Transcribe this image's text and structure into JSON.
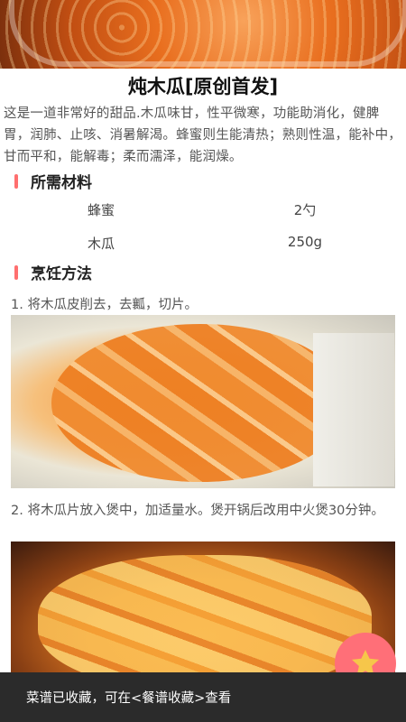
{
  "recipe": {
    "title": "炖木瓜[原创首发]",
    "intro": "这是一道非常好的甜品.木瓜味甘，性平微寒，功能助消化，健脾胃，润肺、止咳、消暑解渴。蜂蜜则生能清热；熟则性温，能补中，甘而平和，能解毒；柔而濡泽，能润燥。"
  },
  "ingredients": {
    "heading": "所需材料",
    "items": [
      {
        "name": "蜂蜜",
        "qty": "2勺"
      },
      {
        "name": "木瓜",
        "qty": "250g"
      }
    ]
  },
  "method": {
    "heading": "烹饪方法",
    "steps": [
      {
        "text": "1. 将木瓜皮削去，去瓤，切片。",
        "image": "papaya-slices-photo"
      },
      {
        "text": "2. 将木瓜片放入煲中，加适量水。煲开锅后改用中火煲30分钟。",
        "image": "papaya-stew-photo"
      }
    ]
  },
  "toast": {
    "message": "菜谱已收藏，可在<餐谱收藏>查看"
  },
  "colors": {
    "accent": "#ff6f78",
    "section_bar": "#ff6f6f",
    "toast_bg": "#2b2b2b"
  },
  "icons": {
    "favorite": "star-icon"
  }
}
